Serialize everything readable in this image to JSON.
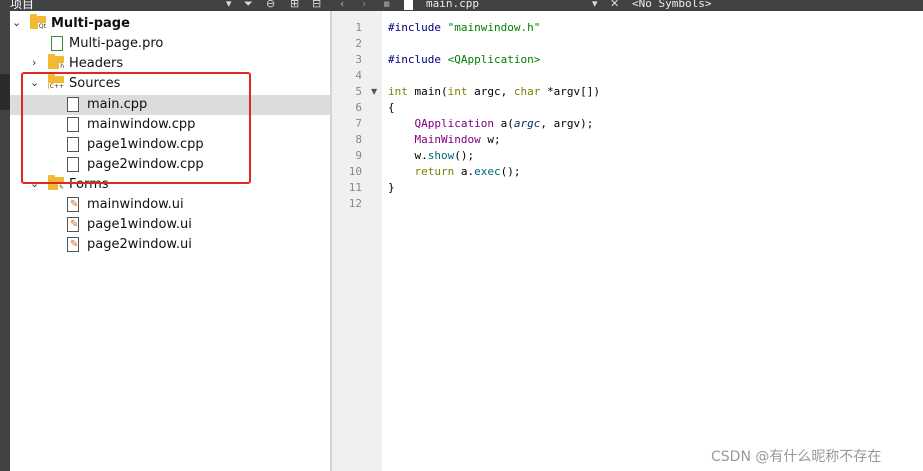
{
  "toolbar": {
    "panel_title": "项目",
    "file_name": "main.cpp",
    "symbols": "<No Symbols>"
  },
  "tree": {
    "project": "Multi-page",
    "project_file": "Multi-page.pro",
    "headers": "Headers",
    "sources": "Sources",
    "source_files": [
      "main.cpp",
      "mainwindow.cpp",
      "page1window.cpp",
      "page2window.cpp"
    ],
    "forms": "Forms",
    "form_files": [
      "mainwindow.ui",
      "page1window.ui",
      "page2window.ui"
    ],
    "selected": "main.cpp"
  },
  "editor": {
    "line_numbers": [
      "1",
      "2",
      "3",
      "4",
      "5",
      "6",
      "7",
      "8",
      "9",
      "10",
      "11",
      "12"
    ],
    "lines": [
      "#include \"mainwindow.h\"",
      "",
      "#include <QApplication>",
      "",
      "int main(int argc, char *argv[])",
      "{",
      "    QApplication a(argc, argv);",
      "    MainWindow w;",
      "    w.show();",
      "    return a.exec();",
      "}",
      ""
    ]
  },
  "watermark": "CSDN @有什么昵称不存在",
  "colors": {
    "highlight_box": "#e0281f",
    "folder": "#f3b935",
    "selection": "#dcdcdc"
  }
}
